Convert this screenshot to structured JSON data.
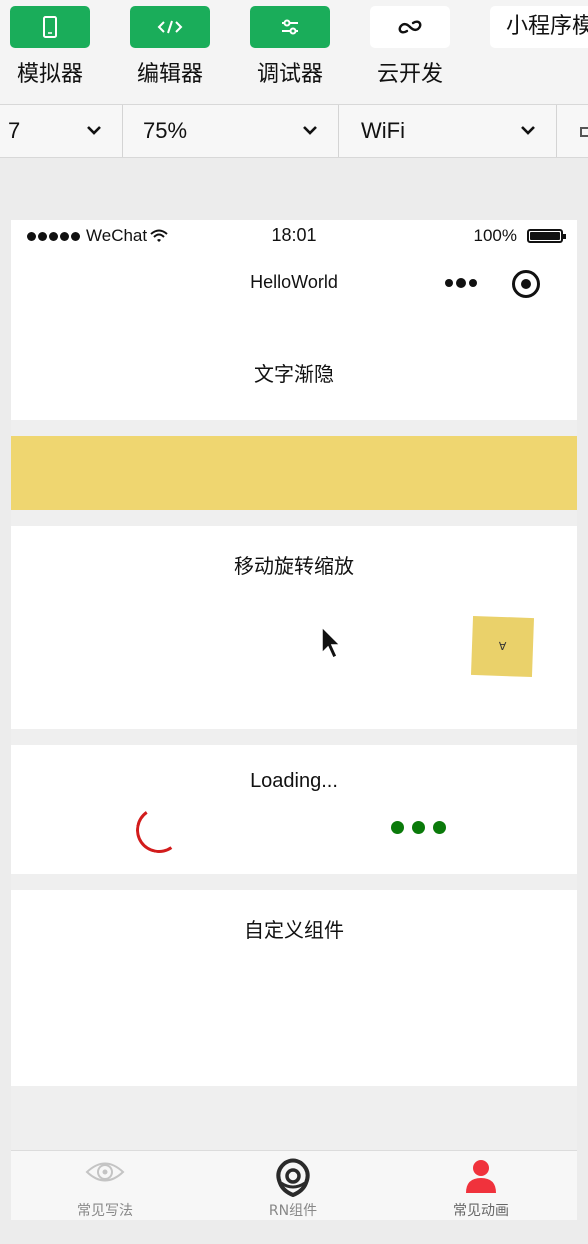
{
  "toolbar": {
    "simulator_label": "模拟器",
    "editor_label": "编辑器",
    "debugger_label": "调试器",
    "cloud_label": "云开发",
    "mini_program_label": "小程序模"
  },
  "dropbar": {
    "device_value": "7",
    "zoom_value": "75%",
    "network_value": "WiFi"
  },
  "phone": {
    "status": {
      "carrier": "WeChat",
      "time": "18:01",
      "battery": "100%"
    },
    "nav_title": "HelloWorld",
    "sections": {
      "fade_title": "文字渐隐",
      "transform_title": "移动旋转缩放",
      "transform_box_glyph": "∀",
      "loading_title": "Loading...",
      "custom_title": "自定义组件"
    },
    "tabs": [
      {
        "label": "常见写法",
        "icon": "eye-icon"
      },
      {
        "label": "RN组件",
        "icon": "react-native-logo-icon"
      },
      {
        "label": "常见动画",
        "icon": "user-icon"
      }
    ]
  },
  "colors": {
    "toolbar_green": "#1aad5a",
    "fade_bar": "#efd670",
    "transform_box": "#ead16a",
    "spinner_red": "#d21c1c",
    "dots_green": "#0a7a0a",
    "active_tab_red": "#f0323c"
  }
}
